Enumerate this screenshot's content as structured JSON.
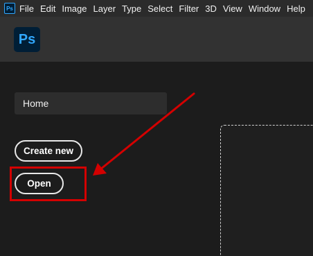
{
  "menubar": {
    "logo_text": "Ps",
    "items": [
      "File",
      "Edit",
      "Image",
      "Layer",
      "Type",
      "Select",
      "Filter",
      "3D",
      "View",
      "Window",
      "Help"
    ]
  },
  "header": {
    "logo_text": "Ps"
  },
  "sidebar": {
    "home_label": "Home",
    "create_new_label": "Create new",
    "open_label": "Open"
  },
  "colors": {
    "accent_blue": "#31a8ff",
    "logo_bg": "#001e36",
    "annotation_red": "#d40000"
  }
}
